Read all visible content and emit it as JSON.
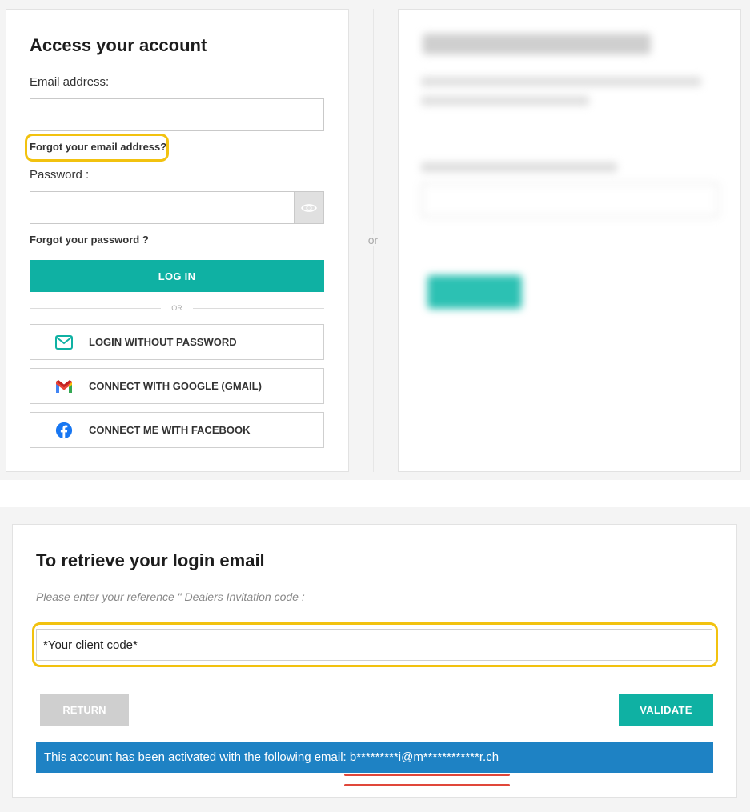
{
  "login": {
    "title": "Access your account",
    "email_label": "Email address:",
    "email_value": "",
    "forgot_email": "Forgot your email address?",
    "password_label": "Password :",
    "password_value": "",
    "forgot_password": "Forgot your password ?",
    "login_button": "LOG IN",
    "or_small": "OR",
    "social": [
      {
        "label": "LOGIN WITHOUT PASSWORD",
        "icon": "mail-icon"
      },
      {
        "label": "CONNECT WITH GOOGLE (GMAIL)",
        "icon": "gmail-icon"
      },
      {
        "label": "CONNECT ME WITH FACEBOOK",
        "icon": "facebook-icon"
      }
    ]
  },
  "separator": {
    "or": "or"
  },
  "retrieve": {
    "title": "To retrieve your login email",
    "note": "Please enter your reference \" Dealers Invitation code :",
    "client_code_value": "*Your client code*",
    "return_button": "RETURN",
    "validate_button": "VALIDATE",
    "info_message": "This account has been activated with the following email: b*********i@m************r.ch"
  },
  "colors": {
    "teal": "#0fb1a3",
    "highlight": "#f2c20f",
    "info_blue": "#1e82c4",
    "underline_red": "#e0473a",
    "gray_button": "#cfcfcf"
  }
}
